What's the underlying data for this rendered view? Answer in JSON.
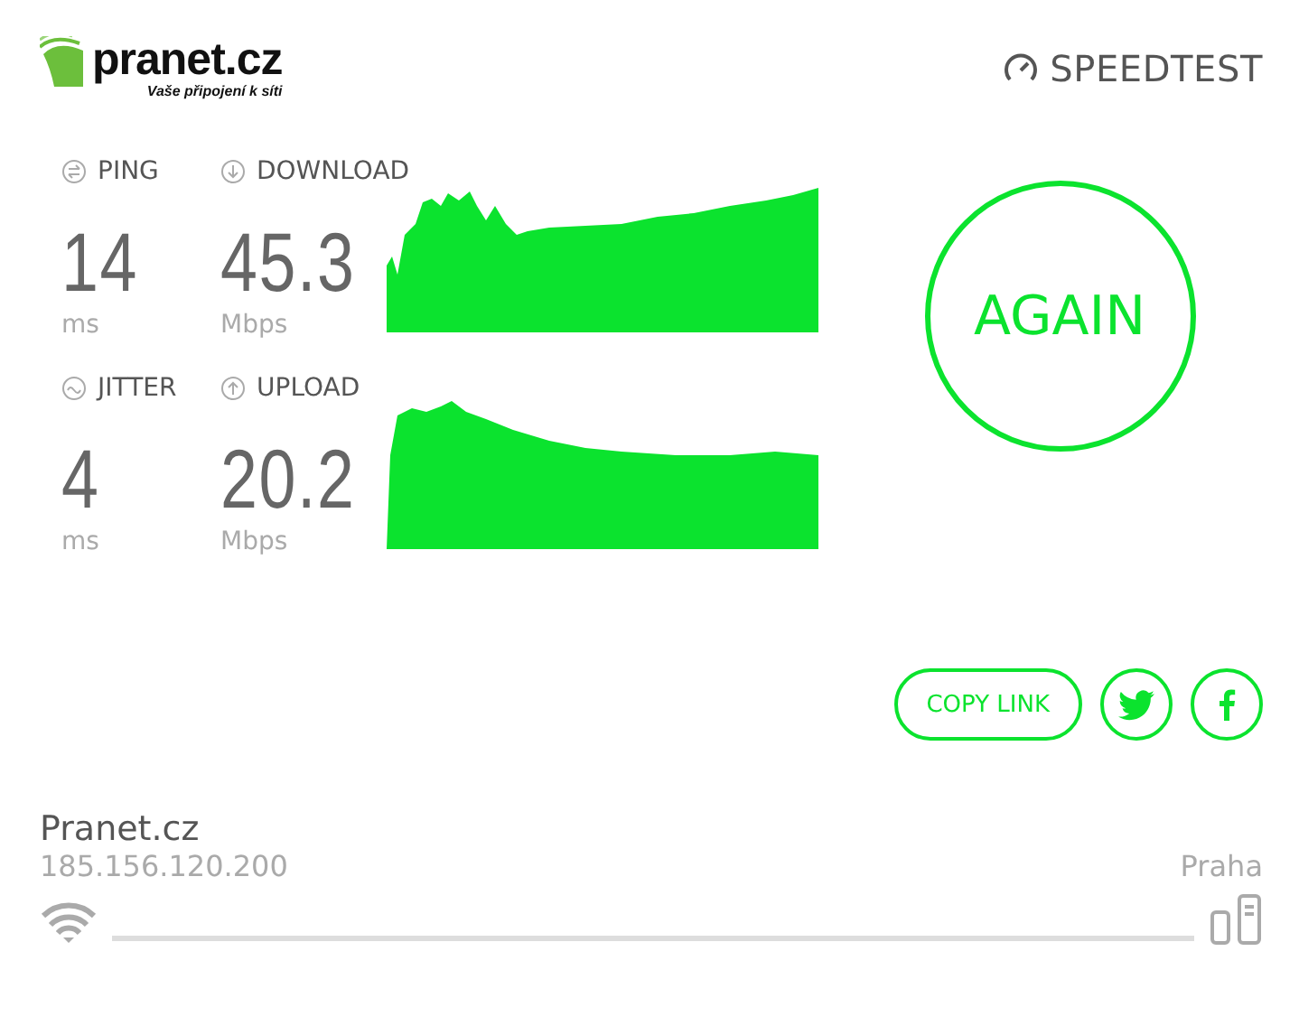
{
  "logo": {
    "name": "pranet.cz",
    "tagline": "Vaše připojení k síti"
  },
  "brand": "SPEEDTEST",
  "rows": [
    {
      "small": {
        "label": "PING",
        "value": "14",
        "unit": "ms"
      },
      "big": {
        "label": "DOWNLOAD",
        "value": "45.3",
        "unit": "Mbps"
      }
    },
    {
      "small": {
        "label": "JITTER",
        "value": "4",
        "unit": "ms"
      },
      "big": {
        "label": "UPLOAD",
        "value": "20.2",
        "unit": "Mbps"
      }
    }
  ],
  "again": "AGAIN",
  "share": {
    "copy": "COPY LINK"
  },
  "isp": {
    "name": "Pranet.cz",
    "ip": "185.156.120.200",
    "server": "Praha"
  }
}
